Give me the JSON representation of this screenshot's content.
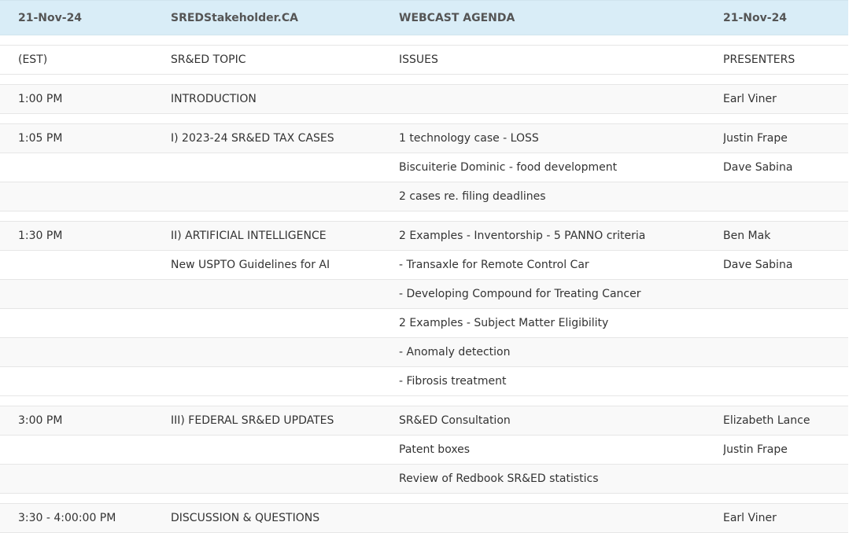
{
  "header": [
    "21-Nov-24",
    "SREDStakeholder.CA",
    "WEBCAST AGENDA",
    "21-Nov-24"
  ],
  "rows": [
    {
      "time": "(EST)",
      "topic": "SR&ED TOPIC",
      "issue": "ISSUES",
      "presenter": "PRESENTERS"
    },
    {
      "time": "1:00 PM",
      "topic": "INTRODUCTION",
      "issue": "",
      "presenter": "Earl Viner"
    },
    {
      "time": "1:05 PM",
      "topic": "I) 2023-24 SR&ED TAX CASES",
      "issue": "1 technology case - LOSS",
      "presenter": "Justin Frape"
    },
    {
      "time": "",
      "topic": "",
      "issue": "Biscuiterie Dominic - food development",
      "presenter": "Dave Sabina"
    },
    {
      "time": "",
      "topic": "",
      "issue": "2 cases re. filing deadlines",
      "presenter": ""
    },
    {
      "time": "1:30 PM",
      "topic": "II) ARTIFICIAL INTELLIGENCE",
      "issue": "2 Examples - Inventorship - 5 PANNO criteria",
      "presenter": "Ben Mak"
    },
    {
      "time": "",
      "topic": "New USPTO Guidelines for AI",
      "issue": "- Transaxle for Remote Control Car",
      "presenter": "Dave Sabina"
    },
    {
      "time": "",
      "topic": "",
      "issue": "- Developing Compound for Treating Cancer",
      "presenter": ""
    },
    {
      "time": "",
      "topic": "",
      "issue": "2 Examples - Subject Matter Eligibility",
      "presenter": ""
    },
    {
      "time": "",
      "topic": "",
      "issue": "- Anomaly detection",
      "presenter": ""
    },
    {
      "time": "",
      "topic": "",
      "issue": "- Fibrosis treatment",
      "presenter": ""
    },
    {
      "time": "3:00 PM",
      "topic": "III) FEDERAL SR&ED UPDATES",
      "issue": "SR&ED Consultation",
      "presenter": "Elizabeth Lance"
    },
    {
      "time": "",
      "topic": "",
      "issue": "Patent boxes",
      "presenter": "Justin Frape"
    },
    {
      "time": "",
      "topic": "",
      "issue": "Review of Redbook SR&ED statistics",
      "presenter": ""
    },
    {
      "time": "3:30 - 4:00:00 PM",
      "topic": "DISCUSSION & QUESTIONS",
      "issue": "",
      "presenter": "Earl Viner"
    }
  ]
}
